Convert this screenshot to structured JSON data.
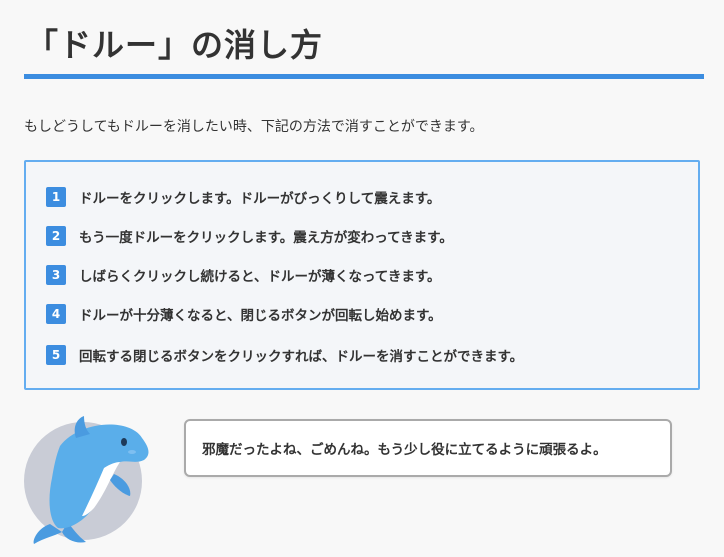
{
  "title": "「ドルー」の消し方",
  "intro": "もしどうしてもドルーを消したい時、下記の方法で消すことができます。",
  "steps": [
    {
      "num": "1",
      "text": "ドルーをクリックします。ドルーがびっくりして震えます。"
    },
    {
      "num": "2",
      "text": "もう一度ドルーをクリックします。震え方が変わってきます。"
    },
    {
      "num": "3",
      "text": "しばらくクリックし続けると、ドルーが薄くなってきます。"
    },
    {
      "num": "4",
      "text": "ドルーが十分薄くなると、閉じるボタンが回転し始めます。"
    },
    {
      "num": "5",
      "text": "回転する閉じるボタンをクリックすれば、ドルーを消すことができます。"
    }
  ],
  "speech": "邪魔だったよね、ごめんね。もう少し役に立てるように頑張るよ。",
  "colors": {
    "accent": "#3c8de0",
    "box_border": "#64adf0",
    "dolphin": "#5aaeea"
  },
  "icons": {
    "mascot": "dolphin-icon"
  }
}
